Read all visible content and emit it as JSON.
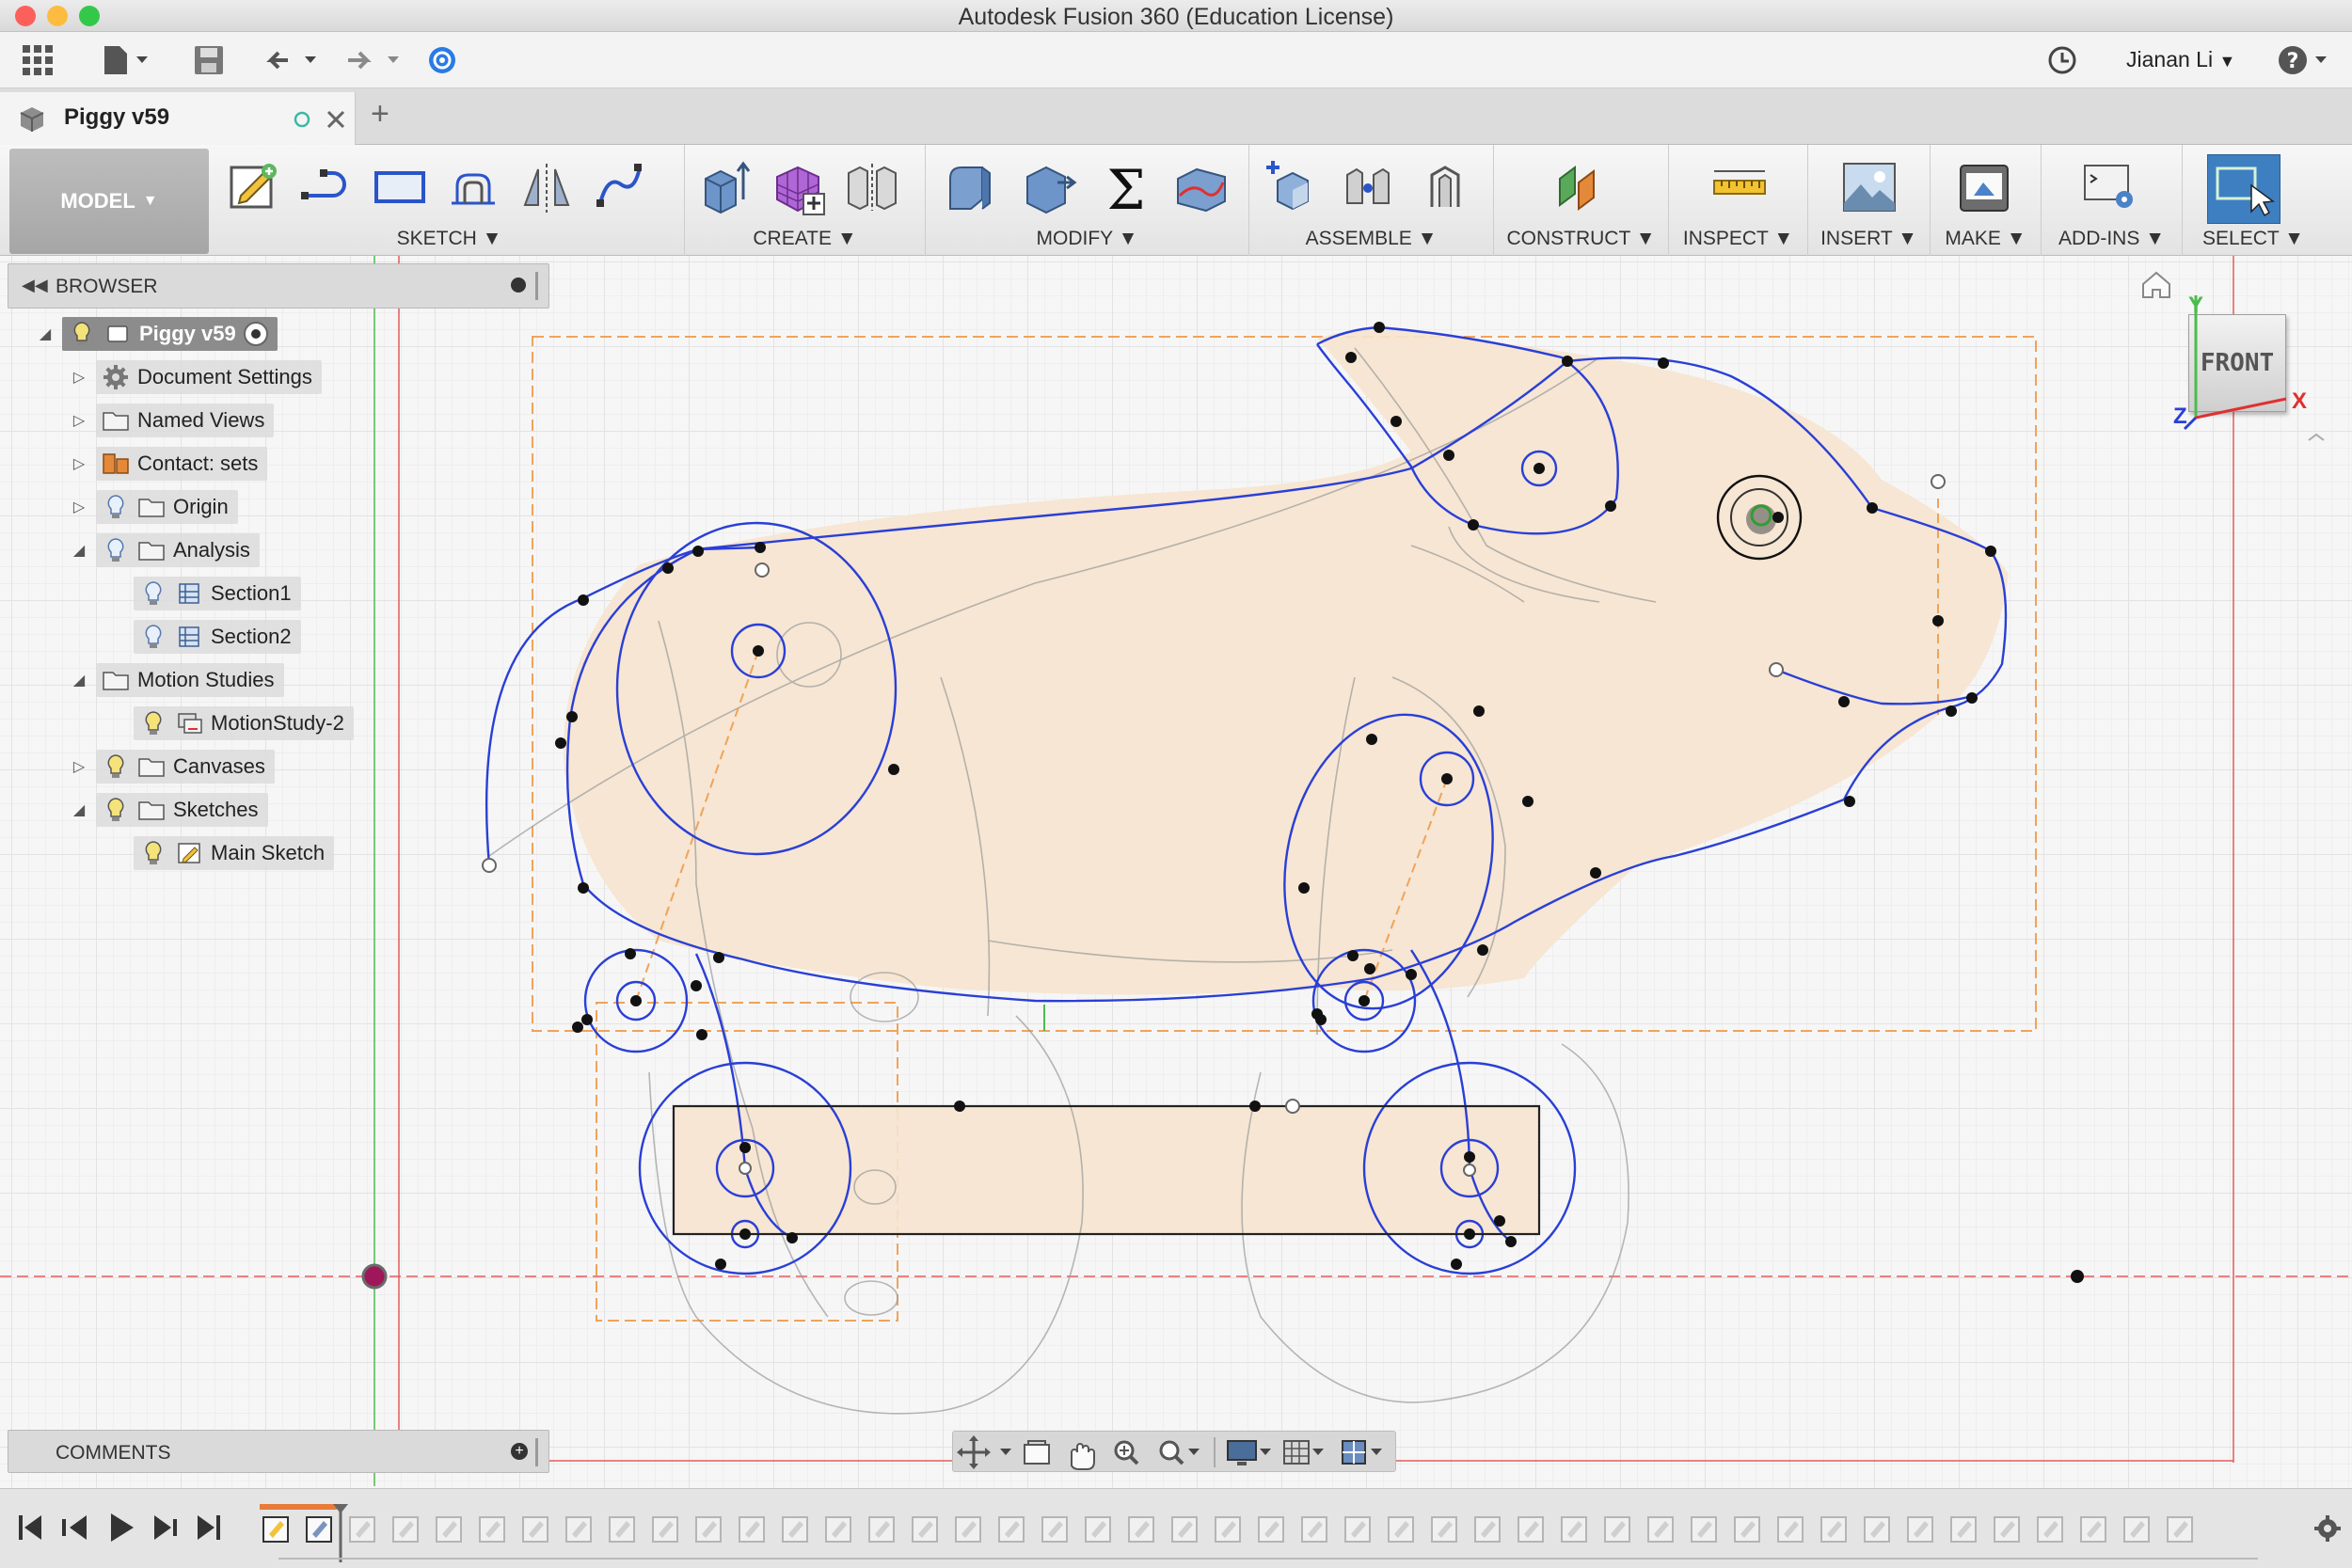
{
  "window": {
    "title": "Autodesk Fusion 360 (Education License)",
    "traffic_lights": [
      "#fc605b",
      "#fdbc40",
      "#34c84a"
    ]
  },
  "quick_access": {
    "icons": [
      "app-grid-icon",
      "file-icon",
      "save-icon",
      "undo-icon",
      "redo-icon",
      "data-panel-icon",
      "job-status-icon",
      "help-icon"
    ],
    "user_name": "Jianan Li"
  },
  "document_tab": {
    "title": "Piggy v59",
    "add_tab": "+"
  },
  "ribbon": {
    "workspace": "MODEL",
    "groups": [
      {
        "label": "SKETCH"
      },
      {
        "label": "CREATE"
      },
      {
        "label": "MODIFY"
      },
      {
        "label": "ASSEMBLE"
      },
      {
        "label": "CONSTRUCT"
      },
      {
        "label": "INSPECT"
      },
      {
        "label": "INSERT"
      },
      {
        "label": "MAKE"
      },
      {
        "label": "ADD-INS"
      },
      {
        "label": "SELECT"
      }
    ]
  },
  "browser": {
    "title": "BROWSER",
    "items": [
      {
        "label": "Piggy v59",
        "icon": "component-icon"
      },
      {
        "label": "Document Settings",
        "icon": "gear-icon"
      },
      {
        "label": "Named Views",
        "icon": "folder-icon"
      },
      {
        "label": "Contact: sets",
        "icon": "contact-sets-icon"
      },
      {
        "label": "Origin",
        "icon": "folder-icon"
      },
      {
        "label": "Analysis",
        "icon": "folder-icon"
      },
      {
        "label": "Section1",
        "icon": "section-analysis-icon"
      },
      {
        "label": "Section2",
        "icon": "section-analysis-icon"
      },
      {
        "label": "Motion Studies",
        "icon": "folder-icon"
      },
      {
        "label": "MotionStudy-2",
        "icon": "motion-study-icon"
      },
      {
        "label": "Canvases",
        "icon": "folder-icon"
      },
      {
        "label": "Sketches",
        "icon": "folder-icon"
      },
      {
        "label": "Main Sketch",
        "icon": "sketch-icon"
      }
    ]
  },
  "comments": {
    "title": "COMMENTS"
  },
  "viewcube": {
    "face": "FRONT",
    "axis_x": "X",
    "axis_y": "Y",
    "axis_z": "Z"
  },
  "colors": {
    "sketch_line": "#2a3fd6",
    "canvas_fill": "#f6e4cf",
    "construction_line": "#f0a35a",
    "origin_red": "#e35b5b",
    "origin_green": "#4dbb4d",
    "select_active": "#3d7fc1"
  },
  "timeline": {
    "controls": [
      "first-frame-icon",
      "previous-step-icon",
      "play-icon",
      "next-step-icon",
      "last-frame-icon"
    ],
    "feature_count": 45
  }
}
